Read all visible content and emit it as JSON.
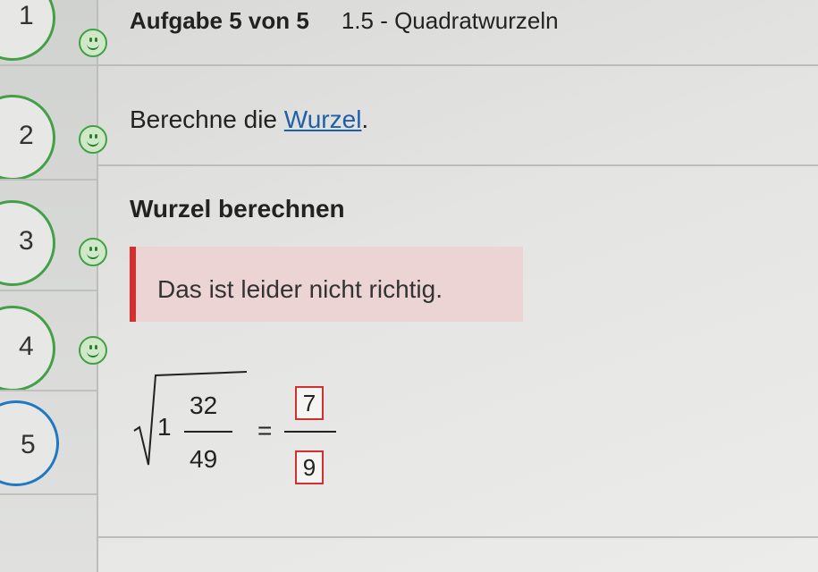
{
  "steps": [
    {
      "number": "1",
      "status": "correct",
      "icon": "smiley-icon"
    },
    {
      "number": "2",
      "status": "correct",
      "icon": "smiley-icon"
    },
    {
      "number": "3",
      "status": "correct",
      "icon": "smiley-icon"
    },
    {
      "number": "4",
      "status": "correct",
      "icon": "smiley-icon"
    },
    {
      "number": "5",
      "status": "current"
    }
  ],
  "header": {
    "task_label": "Aufgabe 5 von 5",
    "topic": "1.5 - Quadratwurzeln"
  },
  "instruction": {
    "prefix": "Berechne die ",
    "link_text": "Wurzel",
    "suffix": "."
  },
  "section_heading": "Wurzel berechnen",
  "feedback": {
    "message": "Das ist leider nicht richtig.",
    "color": "#d32f2f"
  },
  "equation": {
    "whole": "1",
    "numerator": "32",
    "denominator": "49",
    "equals": "=",
    "answer_numerator": "7",
    "answer_denominator": "9"
  },
  "colors": {
    "correct": "#43a047",
    "current": "#1f78c4",
    "link": "#1f5fa8",
    "error": "#d32f2f"
  }
}
